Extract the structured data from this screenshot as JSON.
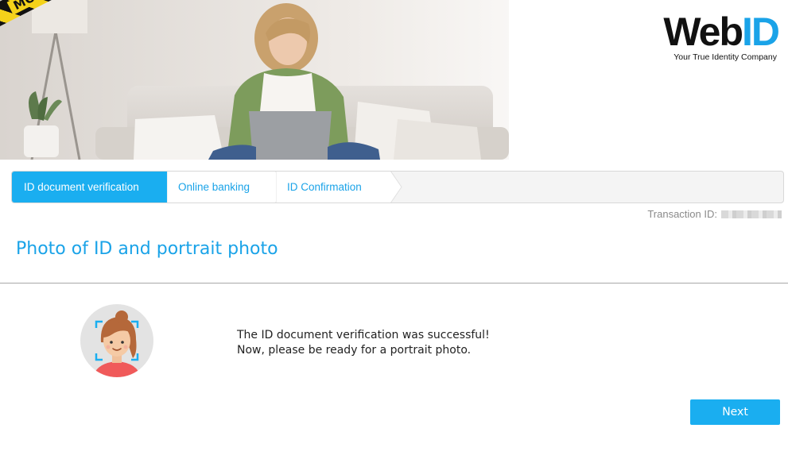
{
  "banner": {
    "testmode_label": "MODE TESTMODE"
  },
  "brand": {
    "logo_part1": "Web",
    "logo_part2": "ID",
    "tagline": "Your True Identity Company",
    "accent_color": "#1aa3e8"
  },
  "stepper": {
    "steps": [
      {
        "label": "ID document verification",
        "active": true
      },
      {
        "label": "Online banking",
        "active": false
      },
      {
        "label": "ID Confirmation",
        "active": false
      }
    ]
  },
  "transaction": {
    "label": "Transaction ID:"
  },
  "main": {
    "title": "Photo of ID and portrait photo",
    "message_line1": "The ID document verification was successful!",
    "message_line2": "Now, please be ready for a portrait photo.",
    "next_label": "Next",
    "avatar_icon": "portrait-face-scan-icon"
  }
}
